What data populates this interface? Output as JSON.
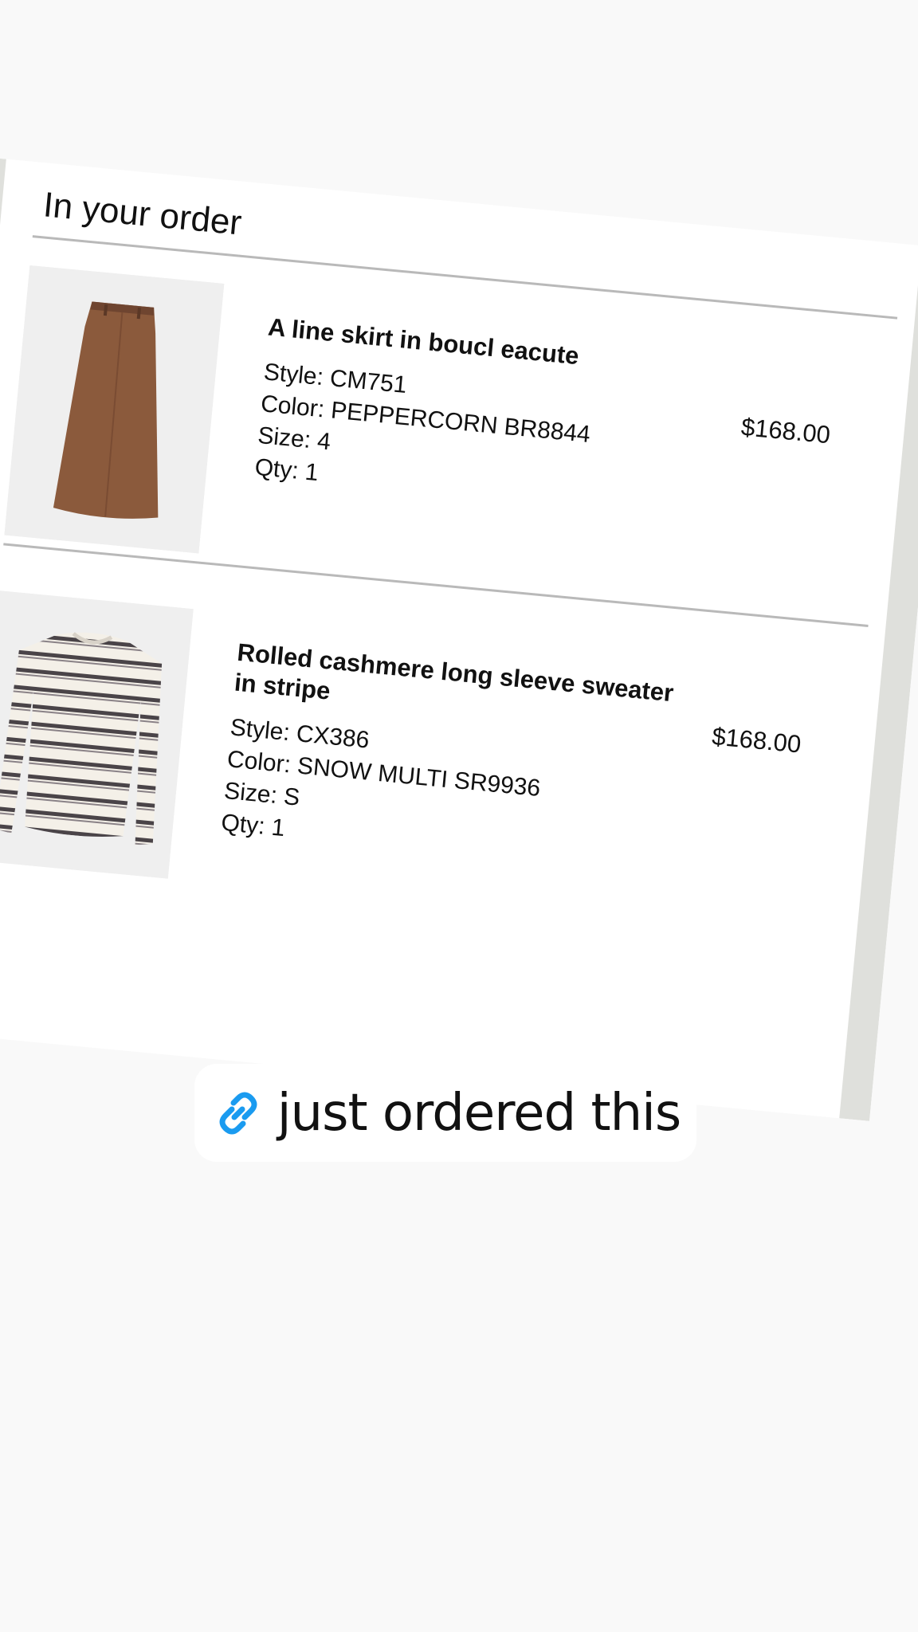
{
  "order": {
    "title": "In your order",
    "items": [
      {
        "name": "A line skirt in boucl eacute",
        "style": "Style: CM751",
        "color": "Color: PEPPERCORN BR8844",
        "size": "Size: 4",
        "qty": "Qty: 1",
        "price": "$168.00",
        "image_icon": "skirt-image",
        "image_color": "#8b5a3c"
      },
      {
        "name": "Rolled cashmere long sleeve sweater in stripe",
        "style": "Style: CX386",
        "color": "Color: SNOW MULTI SR9936",
        "size": "Size: S",
        "qty": "Qty: 1",
        "price": "$168.00",
        "image_icon": "striped-sweater-image",
        "image_colors": [
          "#f4f0e8",
          "#4a4448"
        ]
      }
    ]
  },
  "sticker": {
    "text": "just ordered this",
    "icon": "link-icon",
    "icon_color": "#1a9bf0"
  }
}
